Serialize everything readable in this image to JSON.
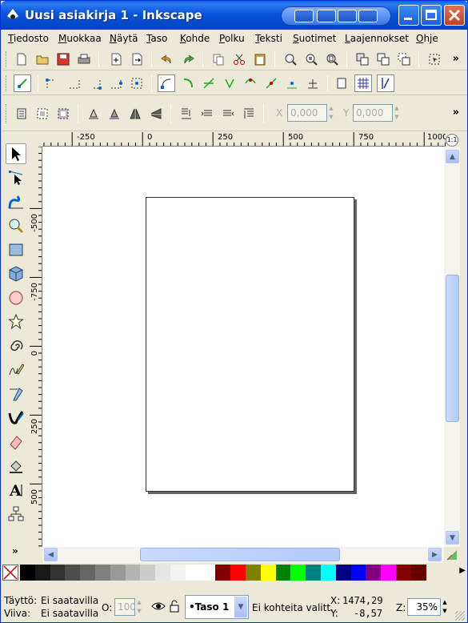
{
  "window": {
    "title": "Uusi asiakirja 1 - Inkscape"
  },
  "menu": [
    "Tiedosto",
    "Muokkaa",
    "Näytä",
    "Taso",
    "Kohde",
    "Polku",
    "Teksti",
    "Suotimet",
    "Laajennokset",
    "Ohje"
  ],
  "toolbar": {
    "overflow": "»"
  },
  "select_toolbar": {
    "x_label": "X",
    "x_value": "0,000",
    "y_label": "Y",
    "y_value": "0,000"
  },
  "ruler": {
    "h_labels": [
      "-250",
      "0",
      "250",
      "500",
      "750",
      "1000"
    ],
    "v_labels": [
      "-500",
      "-750",
      "0",
      "250",
      "500",
      "750"
    ]
  },
  "status": {
    "fill_label": "Täyttö:",
    "fill_value": "Ei saatavilla",
    "stroke_label": "Viiva:",
    "stroke_value": "Ei saatavilla",
    "opacity_label": "O:",
    "opacity_value": "100",
    "layer": "•Taso 1",
    "message": "Ei kohteita valitt.",
    "x_label": "X:",
    "x_value": "1474,29",
    "y_label": "Y:",
    "y_value": "-8,57",
    "zoom_label": "Z:",
    "zoom_value": "35%"
  },
  "palette": [
    "#000000",
    "#1a1a1a",
    "#333333",
    "#4d4d4d",
    "#666666",
    "#808080",
    "#999999",
    "#b3b3b3",
    "#cccccc",
    "#e6e6e6",
    "#f2f2f2",
    "#ffffff",
    "#ffffff",
    "#800000",
    "#ff0000",
    "#808000",
    "#ffff00",
    "#008000",
    "#00ff00",
    "#008080",
    "#00ffff",
    "#000080",
    "#0000ff",
    "#800080",
    "#ff00ff",
    "#800000",
    "#660000"
  ],
  "colors": {
    "titlebar": "#0855dd",
    "accent": "#316ac5"
  }
}
